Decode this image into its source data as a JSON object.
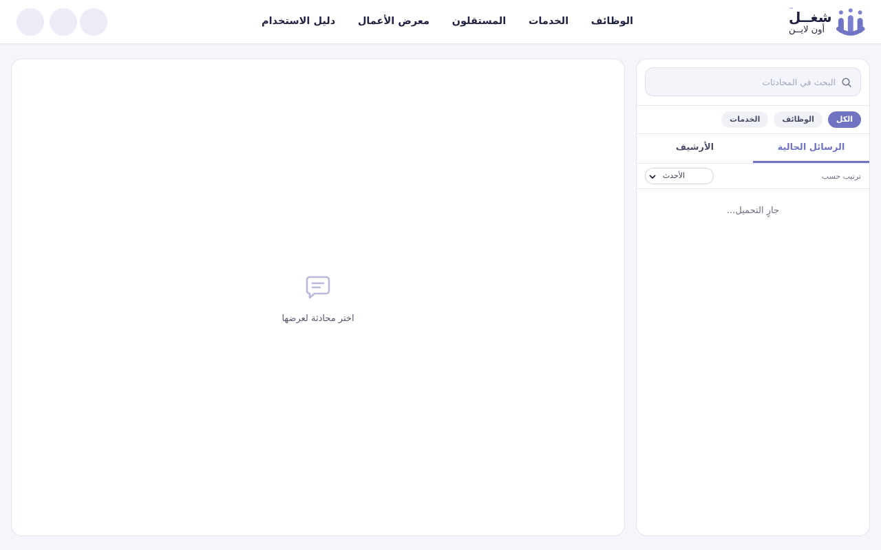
{
  "header": {
    "logo": {
      "main": "شغــل",
      "sub": "أون لايــن",
      "tm": "™"
    },
    "nav": [
      {
        "label": "الوظائف"
      },
      {
        "label": "الخدمات"
      },
      {
        "label": "المستقلون"
      },
      {
        "label": "معرض الأعمال"
      },
      {
        "label": "دليل الاستخدام"
      }
    ],
    "action_count": 3
  },
  "sidebar": {
    "search": {
      "placeholder": "البحث في المحادثات",
      "value": ""
    },
    "filters": [
      {
        "label": "الكل",
        "active": true
      },
      {
        "label": "الوظائف",
        "active": false
      },
      {
        "label": "الخدمات",
        "active": false
      }
    ],
    "tabs": [
      {
        "label": "الرسائل الحالية",
        "active": true
      },
      {
        "label": "الأرشيف",
        "active": false
      }
    ],
    "sort": {
      "label": "ترتيب حسب",
      "selected": "الأحدث"
    },
    "loading_text": "جارٍ التحميل..."
  },
  "main": {
    "empty_text": "اختر محادثة لعرضها"
  },
  "colors": {
    "accent": "#6f73c2",
    "page_bg": "#f5f6fb",
    "text_dark": "#1f2140"
  },
  "icons": [
    "logo-mark-icon",
    "search-icon",
    "chevron-down-icon",
    "chat-bubble-icon"
  ]
}
